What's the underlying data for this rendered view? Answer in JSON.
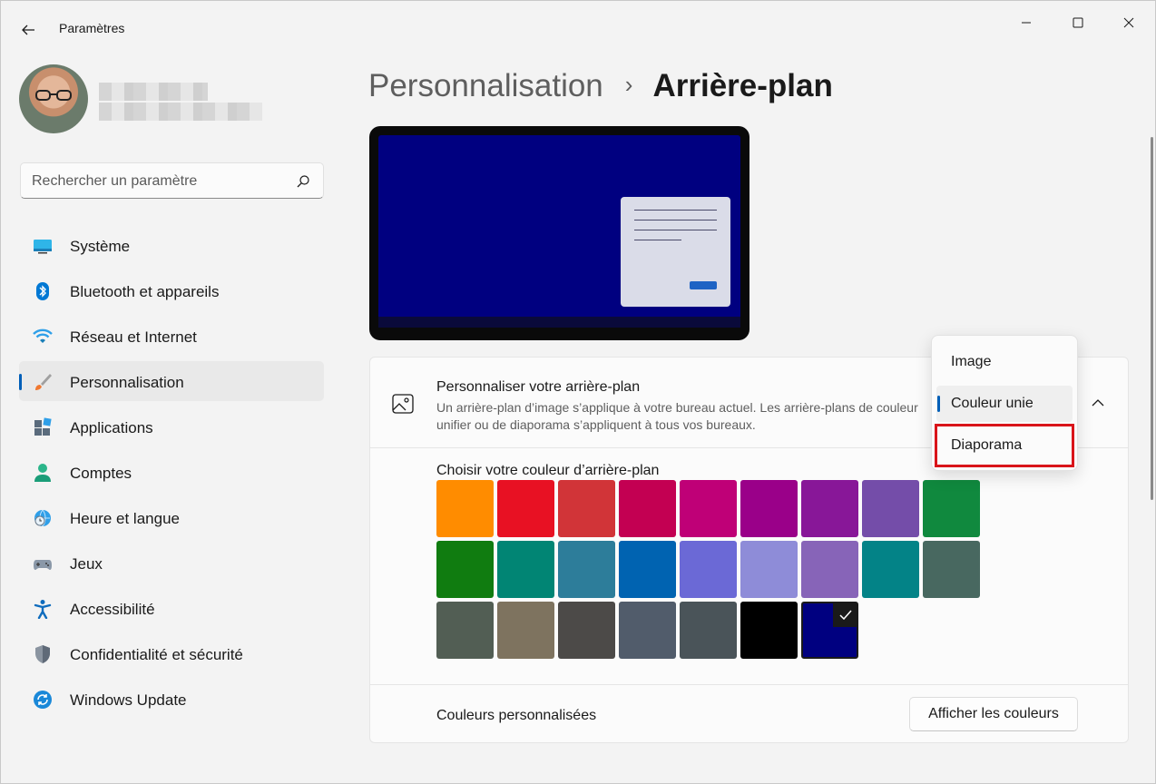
{
  "window": {
    "title": "Paramètres"
  },
  "sidebar": {
    "search_placeholder": "Rechercher un paramètre",
    "items": [
      {
        "label": "Système",
        "icon": "monitor-icon"
      },
      {
        "label": "Bluetooth et appareils",
        "icon": "bluetooth-icon"
      },
      {
        "label": "Réseau et Internet",
        "icon": "wifi-icon"
      },
      {
        "label": "Personnalisation",
        "icon": "brush-icon",
        "active": true
      },
      {
        "label": "Applications",
        "icon": "apps-icon"
      },
      {
        "label": "Comptes",
        "icon": "person-icon"
      },
      {
        "label": "Heure et langue",
        "icon": "globe-clock-icon"
      },
      {
        "label": "Jeux",
        "icon": "gamepad-icon"
      },
      {
        "label": "Accessibilité",
        "icon": "accessibility-icon"
      },
      {
        "label": "Confidentialité et sécurité",
        "icon": "shield-icon"
      },
      {
        "label": "Windows Update",
        "icon": "update-icon"
      }
    ]
  },
  "breadcrumb": {
    "parent": "Personnalisation",
    "separator": "›",
    "current": "Arrière-plan"
  },
  "background_card": {
    "title": "Personnaliser votre arrière-plan",
    "description": "Un arrière-plan d’image s’applique à votre bureau actuel. Les arrière-plans de couleur unifier ou de diaporama s’appliquent à tous vos bureaux.",
    "colors_label": "Choisir votre couleur d’arrière-plan",
    "custom_colors_label": "Couleurs personnalisées",
    "view_colors_button": "Afficher les couleurs",
    "selected_color": "#000080",
    "swatches": [
      [
        "#ff8c00",
        "#e81123",
        "#d13438",
        "#c30052",
        "#bf0077",
        "#9a0089",
        "#881798",
        "#744da9",
        "#10893e"
      ],
      [
        "#107c10",
        "#018574",
        "#2d7d9a",
        "#0063b1",
        "#6b69d6",
        "#8e8cd8",
        "#8764b8",
        "#038387",
        "#486860"
      ],
      [
        "#525e54",
        "#7e735f",
        "#4c4a48",
        "#515c6b",
        "#4a5459",
        "#000000",
        "#000080"
      ]
    ]
  },
  "dropdown": {
    "options": [
      "Image",
      "Couleur unie",
      "Diaporama"
    ],
    "selected": "Couleur unie",
    "highlighted": "Diaporama"
  },
  "colors": {
    "accent": "#005fb8",
    "highlight_box": "#d9141a"
  }
}
